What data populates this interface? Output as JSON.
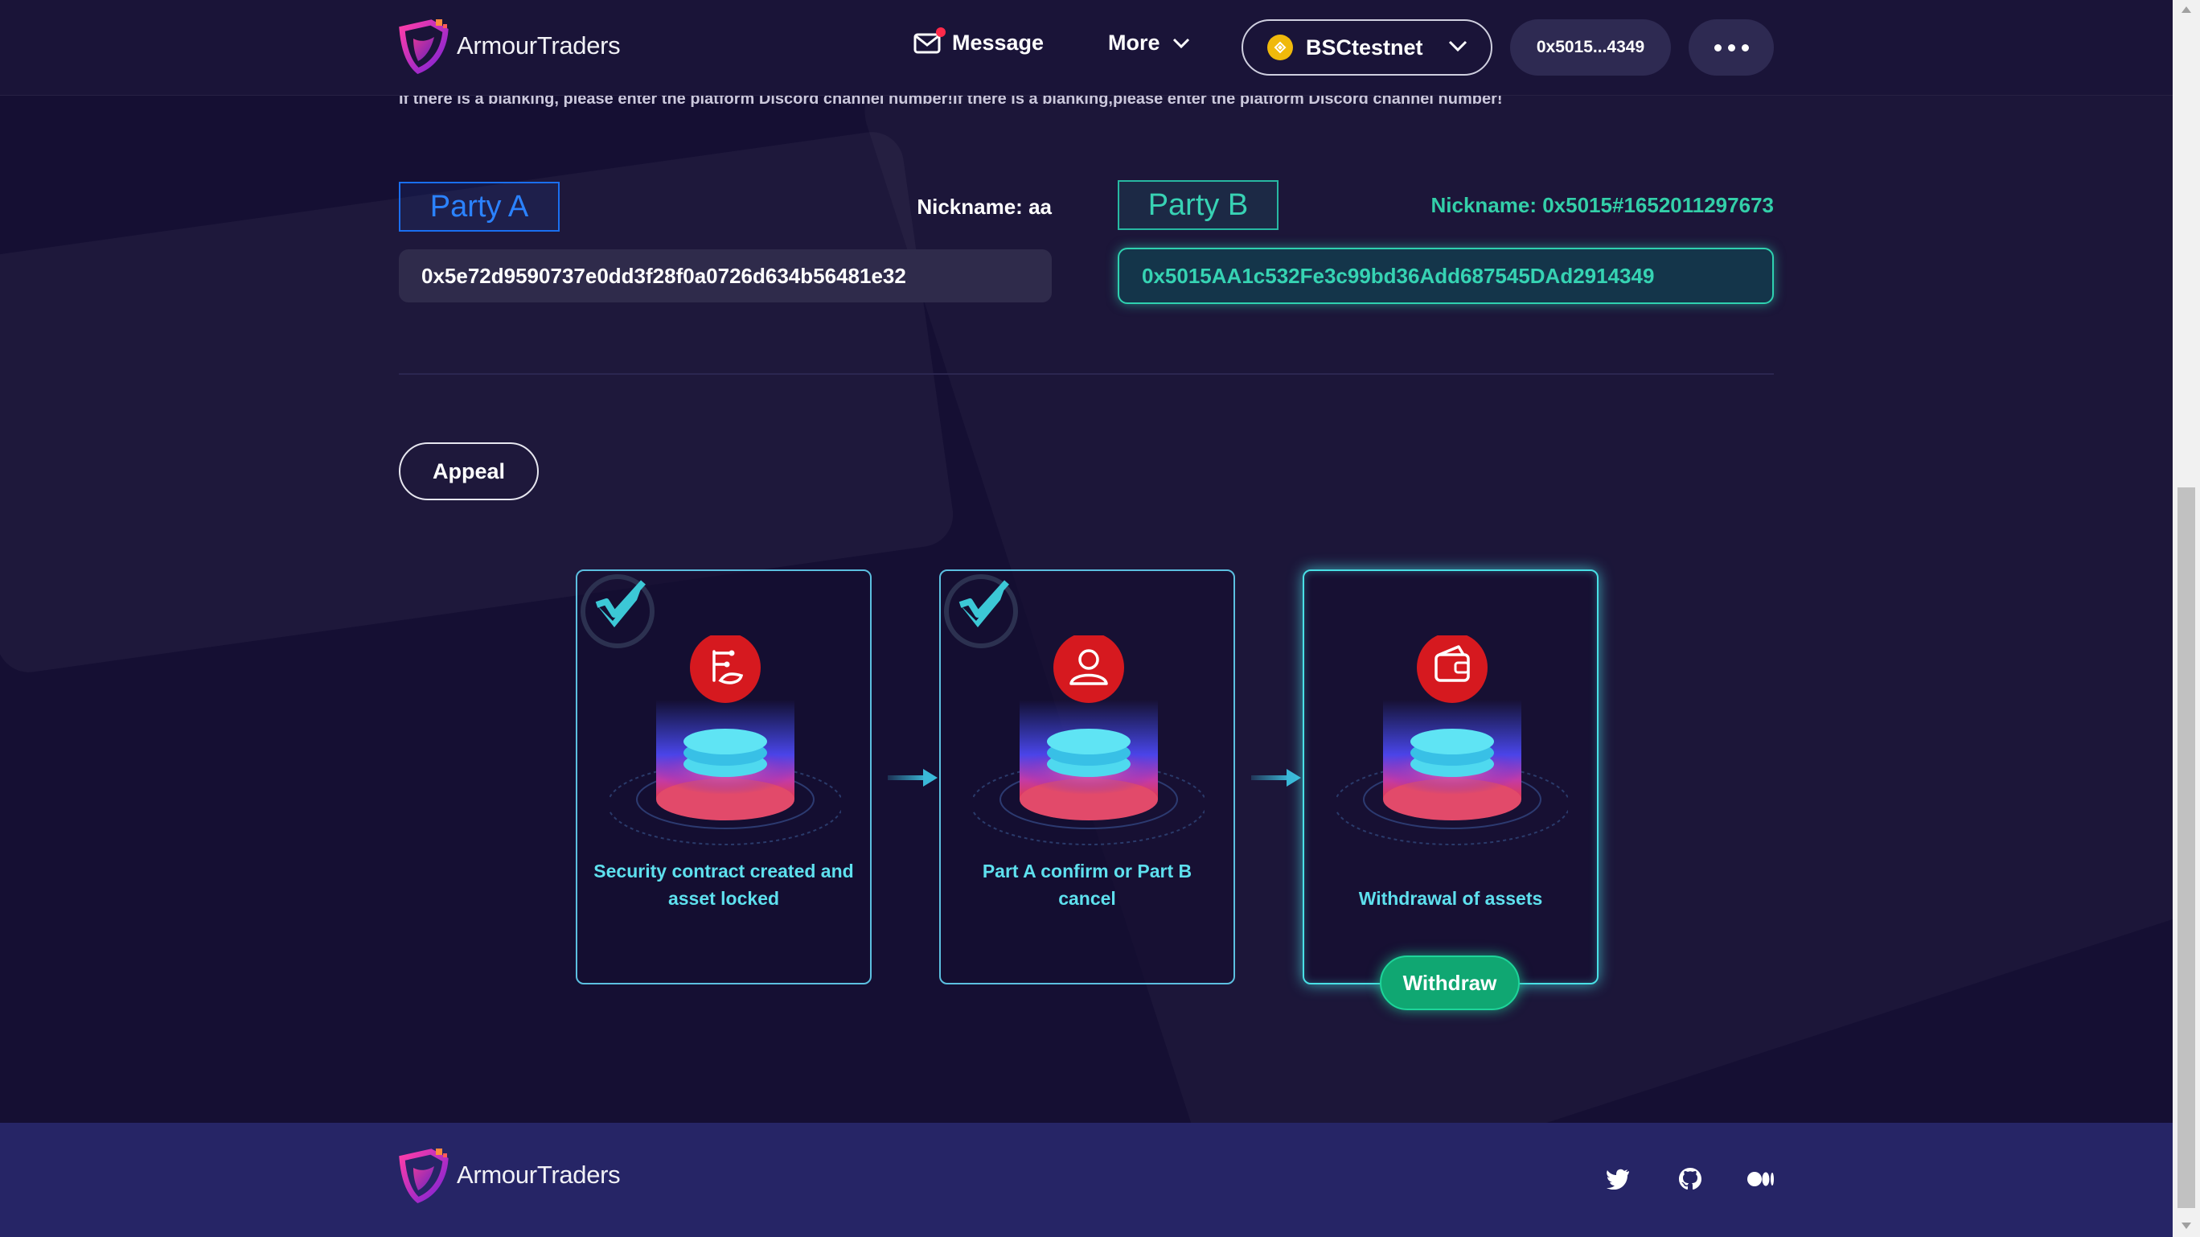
{
  "header": {
    "brand": "ArmourTraders",
    "message_label": "Message",
    "more_label": "More",
    "network_label": "BSCtestnet",
    "wallet_address": "0x5015...4349"
  },
  "notice": "If there is a blanking, please enter the platform Discord channel number!If there is a blanking,please enter the platform Discord channel number!",
  "party_a": {
    "label": "Party A",
    "nickname": "Nickname: aa",
    "address": "0x5e72d9590737e0dd3f28f0a0726d634b56481e32"
  },
  "party_b": {
    "label": "Party B",
    "nickname": "Nickname: 0x5015#1652011297673",
    "address": "0x5015AA1c532Fe3c99bd36Add687545DAd2914349"
  },
  "appeal_label": "Appeal",
  "steps": [
    {
      "text": "Security contract created and asset locked",
      "icon": "contract-icon",
      "completed": true
    },
    {
      "text": "Part A confirm or Part B cancel",
      "icon": "user-icon",
      "completed": true
    },
    {
      "text": "Withdrawal of assets",
      "icon": "wallet-icon",
      "completed": false
    }
  ],
  "withdraw_label": "Withdraw",
  "footer": {
    "brand": "ArmourTraders",
    "social": [
      "twitter-icon",
      "github-icon",
      "medium-icon"
    ]
  },
  "colors": {
    "party_a_accent": "#2b82ff",
    "party_b_accent": "#36d3b3",
    "step_text": "#5ee0ee",
    "withdraw": "#10a772",
    "background": "#150f33",
    "footer": "#262566"
  }
}
